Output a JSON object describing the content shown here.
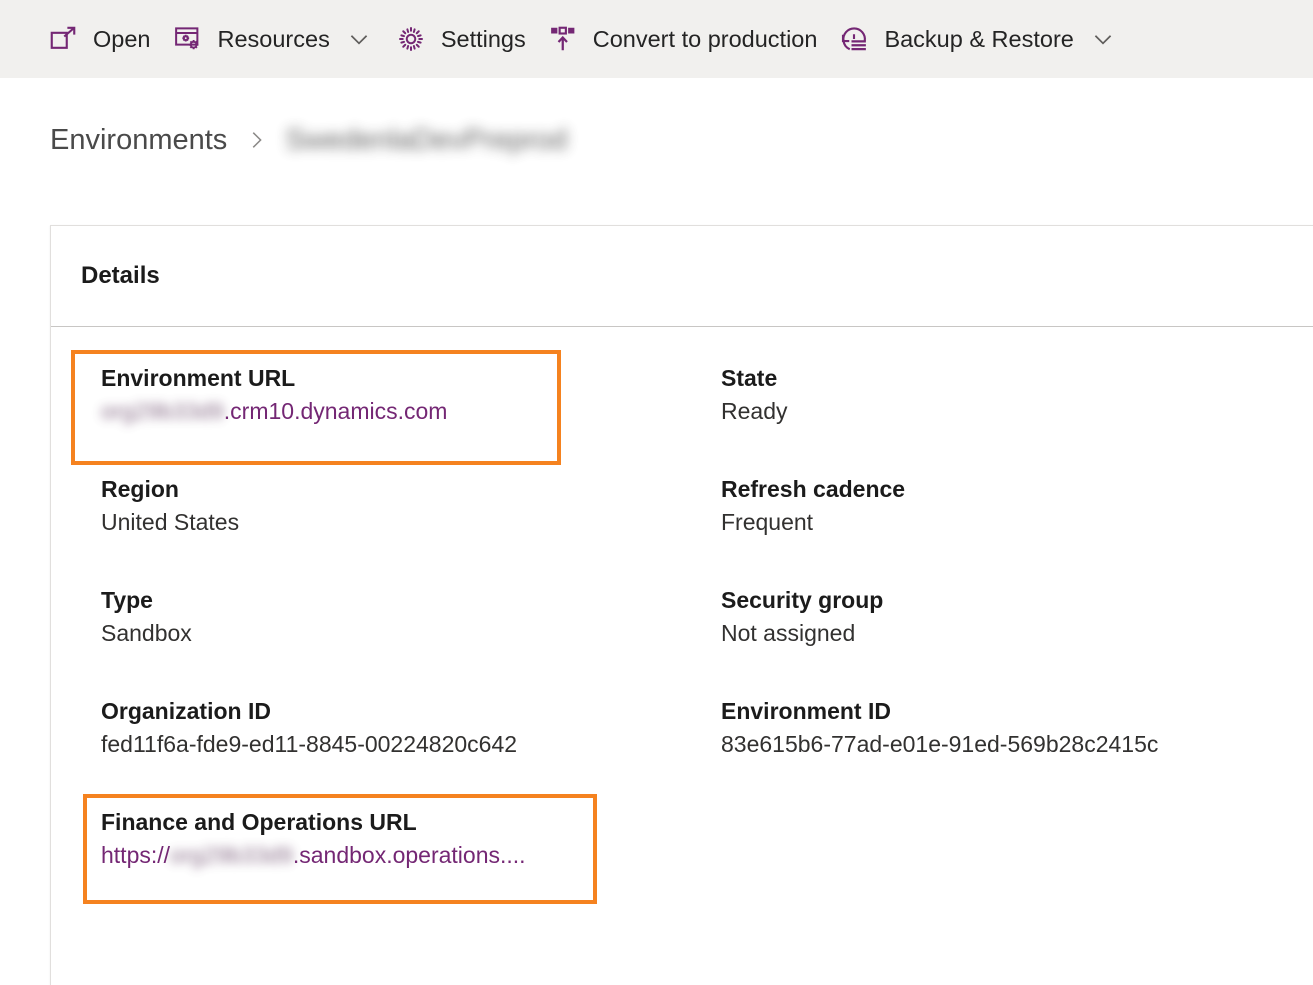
{
  "commandbar": {
    "items": [
      {
        "label": "Open",
        "icon": "open-in-new-window-icon",
        "has_chevron": false
      },
      {
        "label": "Resources",
        "icon": "resources-window-gear-icon",
        "has_chevron": true
      },
      {
        "label": "Settings",
        "icon": "gear-icon",
        "has_chevron": false
      },
      {
        "label": "Convert to production",
        "icon": "convert-to-production-icon",
        "has_chevron": false
      },
      {
        "label": "Backup & Restore",
        "icon": "backup-restore-history-icon",
        "has_chevron": true
      }
    ]
  },
  "breadcrumb": {
    "root_label": "Environments",
    "separator_icon": "chevron-right-icon",
    "current_label": "SwedenlaDevPreprod"
  },
  "card": {
    "title": "Details",
    "left_fields": [
      {
        "label": "Environment URL",
        "value_prefix": "org29b33d9",
        "value": ".crm10.dynamics.com",
        "is_link": true,
        "redacted_prefix": true,
        "highlighted": true
      },
      {
        "label": "Region",
        "value": "United States",
        "is_link": false
      },
      {
        "label": "Type",
        "value": "Sandbox",
        "is_link": false
      },
      {
        "label": "Organization ID",
        "value": "fed11f6a-fde9-ed11-8845-00224820c642",
        "is_link": false
      },
      {
        "label": "Finance and Operations URL",
        "value_prefix_plain": "https://",
        "value_prefix": "org29b33d9",
        "value": ".sandbox.operations....",
        "is_link": true,
        "redacted_prefix": true,
        "highlighted": true
      }
    ],
    "right_fields": [
      {
        "label": "State",
        "value": "Ready",
        "is_link": false
      },
      {
        "label": "Refresh cadence",
        "value": "Frequent",
        "is_link": false
      },
      {
        "label": "Security group",
        "value": "Not assigned",
        "is_link": false
      },
      {
        "label": "Environment ID",
        "value": "83e615b6-77ad-e01e-91ed-569b28c2415c",
        "is_link": false
      }
    ]
  },
  "colors": {
    "accent_purple": "#742774",
    "highlight_orange": "#F5821F",
    "commandbar_background": "#F1F0EE",
    "card_border": "#E1DFDD",
    "text_primary": "#1b1b1b"
  }
}
